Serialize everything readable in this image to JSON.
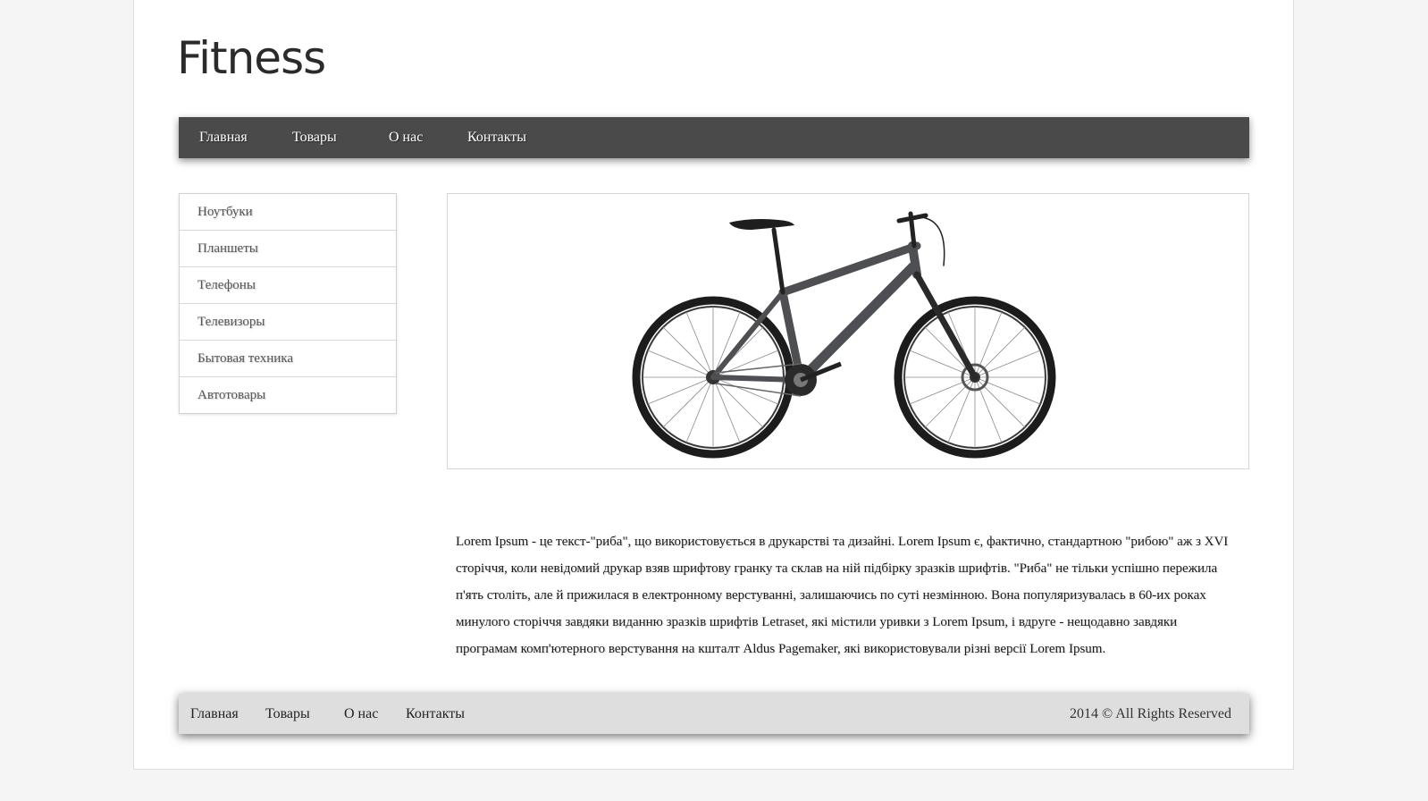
{
  "brand": {
    "title": "Fitness"
  },
  "top_nav": [
    "Главная",
    "Товары",
    "О нас",
    "Контакты"
  ],
  "sidebar": {
    "items": [
      "Ноутбуки",
      "Планшеты",
      "Телефоны",
      "Телевизоры",
      "Бытовая техника",
      "Автотовары"
    ]
  },
  "hero": {
    "image": "mountain-bike-photo"
  },
  "description": "Lorem Ipsum - це текст-\"риба\", що використовується в друкарстві та дизайні. Lorem Ipsum є, фактично, стандартною \"рибою\" аж з XVI сторіччя, коли невідомий друкар взяв шрифтову гранку та склав на ній підбірку зразків шрифтів. \"Риба\" не тільки успішно пережила п'ять століть, але й прижилася в електронному верстуванні, залишаючись по суті незмінною. Вона популяризувалась в 60-их роках минулого сторіччя завдяки виданню зразків шрифтів Letraset, які містили уривки з Lorem Ipsum, і вдруге - нещодавно завдяки програмам комп'ютерного верстування на кшталт Aldus Pagemaker, які використовували різні версії Lorem Ipsum.",
  "footer": {
    "nav": [
      "Главная",
      "Товары",
      "О нас",
      "Контакты"
    ],
    "copyright": "2014 © All Rights Reserved"
  },
  "colors": {
    "nav_background": "#4a4a4a",
    "footer_background": "#dedede",
    "page_background": "#f5f5f5"
  }
}
